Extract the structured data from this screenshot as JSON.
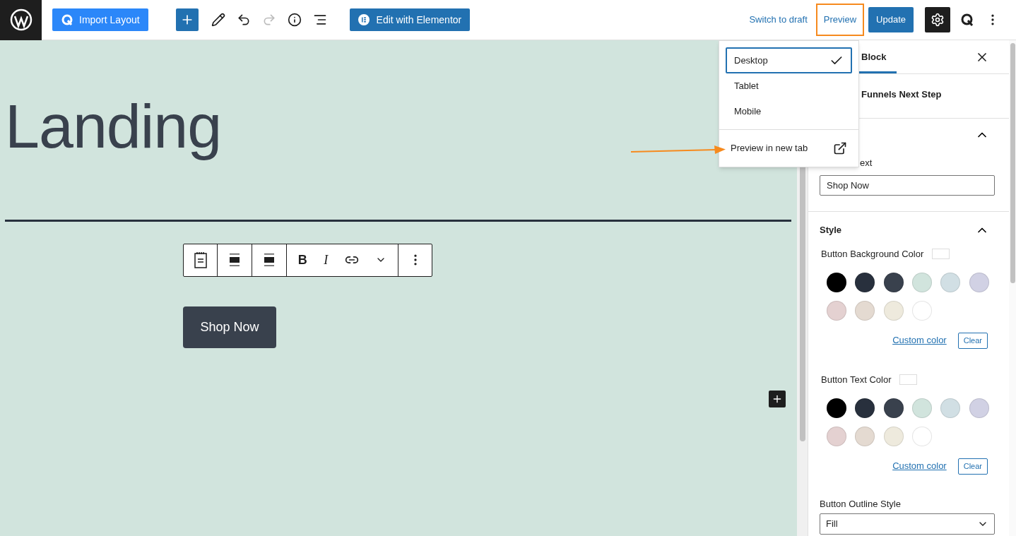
{
  "topbar": {
    "import_layout": "Import Layout",
    "edit_with_elementor": "Edit with Elementor",
    "switch_to_draft": "Switch to draft",
    "preview": {
      "label": "Preview",
      "highlighted": true
    },
    "update": "Update"
  },
  "canvas": {
    "title": "Landing",
    "button": "Shop Now"
  },
  "block_toolbar": {
    "format_buttons": [
      "B",
      "I"
    ]
  },
  "preview_menu": {
    "items": [
      {
        "label": "Desktop",
        "selected": true
      },
      {
        "label": "Tablet",
        "selected": false
      },
      {
        "label": "Mobile",
        "selected": false
      }
    ],
    "new_tab": "Preview in new tab"
  },
  "sidebar": {
    "tab": "Block",
    "block_name": "Funnels Next Step",
    "text_section": {
      "label": "ext",
      "value": "Shop Now",
      "expanded": true
    },
    "style_section": {
      "title": "Style",
      "expanded": true,
      "color_settings": [
        {
          "label": "Button Background Color",
          "custom": "Custom color",
          "clear": "Clear"
        },
        {
          "label": "Button Text Color",
          "custom": "Custom color",
          "clear": "Clear"
        }
      ],
      "palette": [
        {
          "color": "#000000"
        },
        {
          "color": "#28303d"
        },
        {
          "color": "#39414d"
        },
        {
          "color": "#d1e4dd"
        },
        {
          "color": "#d1dfe4"
        },
        {
          "color": "#d1d1e4"
        },
        {
          "color": "#e4d1d1"
        },
        {
          "color": "#e4dad1"
        },
        {
          "color": "#eeeadd"
        },
        {
          "color": "#ffffff"
        }
      ],
      "outline_label": "Button Outline Style",
      "outline_value": "Fill"
    }
  }
}
